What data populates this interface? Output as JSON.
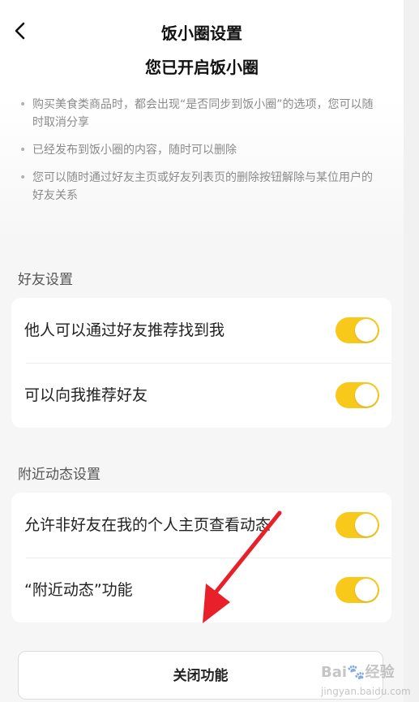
{
  "header": {
    "title": "饭小圈设置",
    "subtitle": "您已开启饭小圈"
  },
  "intro_bullets": [
    "购买美食类商品时，都会出现“是否同步到饭小圈”的选项，您可以随时取消分享",
    "已经发布到饭小圈的内容，随时可以删除",
    "您可以随时通过好友主页或好友列表页的删除按钮解除与某位用户的好友关系"
  ],
  "friend_settings": {
    "label": "好友设置",
    "rows": [
      {
        "label": "他人可以通过好友推荐找到我",
        "enabled": true
      },
      {
        "label": "可以向我推荐好友",
        "enabled": true
      }
    ]
  },
  "nearby_settings": {
    "label": "附近动态设置",
    "rows": [
      {
        "label": "允许非好友在我的个人主页查看动态",
        "enabled": true
      },
      {
        "label": "“附近动态”功能",
        "enabled": true
      }
    ]
  },
  "close_button": {
    "label": "关闭功能"
  },
  "watermark": {
    "brand": "Bai",
    "suffix": "经验",
    "domain": "jingyan.baidu.com"
  },
  "colors": {
    "toggle_on": "#f8c91a",
    "arrow": "#e8202a"
  }
}
